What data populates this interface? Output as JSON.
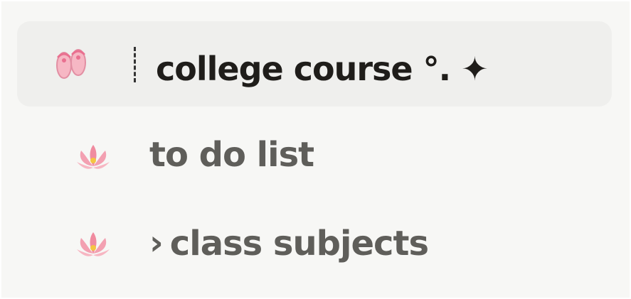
{
  "sidebar": {
    "items": [
      {
        "label": "college course °. ✦",
        "icon": "ballet-shoes-icon",
        "active": true
      },
      {
        "label": "to do list",
        "icon": "lotus-icon",
        "active": false
      },
      {
        "label": "class subjects",
        "prefix": "›",
        "icon": "lotus-icon",
        "active": false
      }
    ]
  },
  "colors": {
    "page_bg": "#f7f7f5",
    "active_bg": "#efefed",
    "primary_text": "#1f1d1a",
    "secondary_text": "#5f5e5a",
    "pink": "#f2a5b4",
    "lotus_pink": "#f08b9f",
    "lotus_yellow": "#f5c542"
  }
}
